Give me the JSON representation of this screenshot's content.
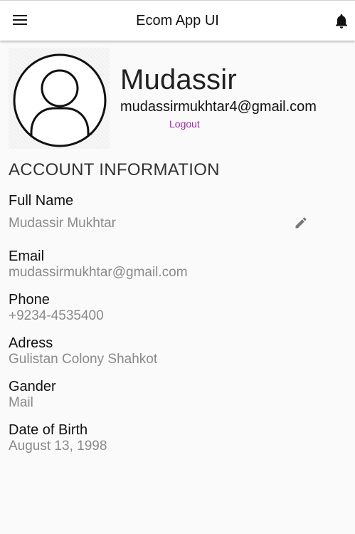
{
  "app_bar": {
    "title": "Ecom App UI",
    "menu_icon": "menu-icon",
    "notification_icon": "bell-icon"
  },
  "profile": {
    "name": "Mudassir",
    "email": "mudassirmukhtar4@gmail.com",
    "logout_label": "Logout",
    "avatar_icon": "person-avatar-icon"
  },
  "account": {
    "section_title": "ACCOUNT INFORMATION",
    "fields": [
      {
        "label": "Full Name",
        "value": "Mudassir Mukhtar"
      },
      {
        "label": "Email",
        "value": "mudassirmukhtar@gmail.com"
      },
      {
        "label": "Phone",
        "value": "+9234-4535400"
      },
      {
        "label": "Adress",
        "value": "Gulistan Colony Shahkot"
      },
      {
        "label": "Gander",
        "value": "Mail"
      },
      {
        "label": "Date of Birth",
        "value": "August 13, 1998"
      }
    ],
    "edit_icon": "edit-pencil-icon"
  },
  "colors": {
    "accent": "#9c27b0",
    "label_text": "#111111",
    "value_text": "#8a8a8a",
    "background": "#fafafa"
  }
}
